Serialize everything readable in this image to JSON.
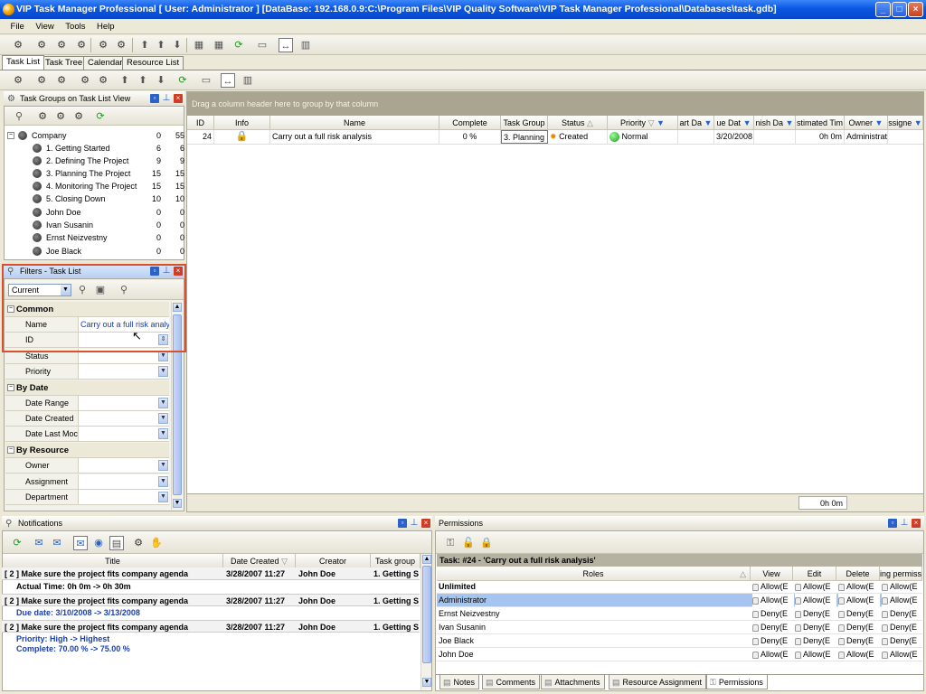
{
  "window": {
    "title": "VIP Task Manager Professional [ User: Administrator ] [DataBase: 192.168.0.9:C:\\Program Files\\VIP Quality Software\\VIP Task Manager Professional\\Databases\\task.gdb]",
    "min": "_",
    "max": "□",
    "close": "×"
  },
  "menu": [
    "File",
    "View",
    "Tools",
    "Help"
  ],
  "tabs": [
    "Task List",
    "Task Tree",
    "Calendar",
    "Resource List"
  ],
  "task_groups": {
    "title": "Task Groups on Task List View",
    "items": [
      {
        "label": "Company",
        "c1": "0",
        "c2": "55"
      },
      {
        "label": "1. Getting Started",
        "c1": "6",
        "c2": "6"
      },
      {
        "label": "2. Defining The Project",
        "c1": "9",
        "c2": "9"
      },
      {
        "label": "3. Planning The Project",
        "c1": "15",
        "c2": "15"
      },
      {
        "label": "4. Monitoring The Project",
        "c1": "15",
        "c2": "15"
      },
      {
        "label": "5. Closing Down",
        "c1": "10",
        "c2": "10"
      },
      {
        "label": "John Doe",
        "c1": "0",
        "c2": "0"
      },
      {
        "label": "Ivan Susanin",
        "c1": "0",
        "c2": "0"
      },
      {
        "label": "Ernst Neizvestny",
        "c1": "0",
        "c2": "0"
      },
      {
        "label": "Joe Black",
        "c1": "0",
        "c2": "0"
      }
    ]
  },
  "filters": {
    "title": "Filters - Task List",
    "current": "Current",
    "common": "Common",
    "by_date": "By Date",
    "by_resource": "By Resource",
    "name_label": "Name",
    "name_value": "Carry out a full risk analysis",
    "id_label": "ID",
    "status_label": "Status",
    "priority_label": "Priority",
    "date_range": "Date Range",
    "date_created": "Date Created",
    "date_last_mod": "Date Last Moc",
    "owner": "Owner",
    "assignment": "Assignment",
    "department": "Department"
  },
  "grid": {
    "group_hint": "Drag a column header here to group by that column",
    "headers": [
      "ID",
      "Info",
      "Name",
      "Complete",
      "Task Group",
      "Status",
      "Priority",
      "art Da",
      "ue Dat",
      "nish Da",
      "stimated Tim",
      "Owner",
      "ssigne"
    ],
    "row": {
      "id": "24",
      "name": "Carry out a full risk analysis",
      "complete": "0 %",
      "group": "3. Planning",
      "status": "Created",
      "priority": "Normal",
      "due": "3/20/2008",
      "estimated": "0h 0m",
      "owner": "Administrat"
    },
    "footer_total": "0h 0m"
  },
  "notifications": {
    "title": "Notifications",
    "headers": [
      "Title",
      "Date Created",
      "Creator",
      "Task group"
    ],
    "rows": [
      {
        "title": "[ 2 ] Make sure the project fits company agenda",
        "date": "3/28/2007 11:27",
        "creator": "John Doe",
        "group": "1. Getting S",
        "detail": "Actual Time: 0h 0m -> 0h 30m"
      },
      {
        "title": "[ 2 ] Make sure the project fits company agenda",
        "date": "3/28/2007 11:27",
        "creator": "John Doe",
        "group": "1. Getting S",
        "detail": "Due date: 3/10/2008 -> 3/13/2008"
      },
      {
        "title": "[ 2 ] Make sure the project fits company agenda",
        "date": "3/28/2007 11:27",
        "creator": "John Doe",
        "group": "1. Getting S",
        "detail": "Priority: High -> Highest",
        "detail2": "Complete: 70.00 % -> 75.00 %"
      }
    ]
  },
  "permissions": {
    "title": "Permissions",
    "task_caption": "Task: #24 - 'Carry out a full risk analysis'",
    "headers": [
      "Roles",
      "View",
      "Edit",
      "Delete",
      "ing permiss"
    ],
    "rows": [
      {
        "role": "Unlimited",
        "v": "Allow(E",
        "e": "Allow(E",
        "d": "Allow(E",
        "p": "Allow(E"
      },
      {
        "role": "Administrator",
        "v": "Allow(E",
        "e": "Allow(E",
        "d": "Allow(E",
        "p": "Allow(E"
      },
      {
        "role": "Ernst Neizvestny",
        "v": "Deny(E",
        "e": "Deny(E",
        "d": "Deny(E",
        "p": "Deny(E"
      },
      {
        "role": "Ivan Susanin",
        "v": "Deny(E",
        "e": "Deny(E",
        "d": "Deny(E",
        "p": "Deny(E"
      },
      {
        "role": "Joe Black",
        "v": "Deny(E",
        "e": "Deny(E",
        "d": "Deny(E",
        "p": "Deny(E"
      },
      {
        "role": "John Doe",
        "v": "Allow(E",
        "e": "Allow(E",
        "d": "Allow(E",
        "p": "Allow(E"
      }
    ]
  },
  "bottom_tabs": [
    "Notes",
    "Comments",
    "Attachments",
    "Resource Assignment",
    "Permissions"
  ],
  "colors": {
    "title_bar": "#0a58e3",
    "selection": "#a6c4f0",
    "highlight_border": "#d9502c",
    "link_blue": "#1b3fb0"
  }
}
